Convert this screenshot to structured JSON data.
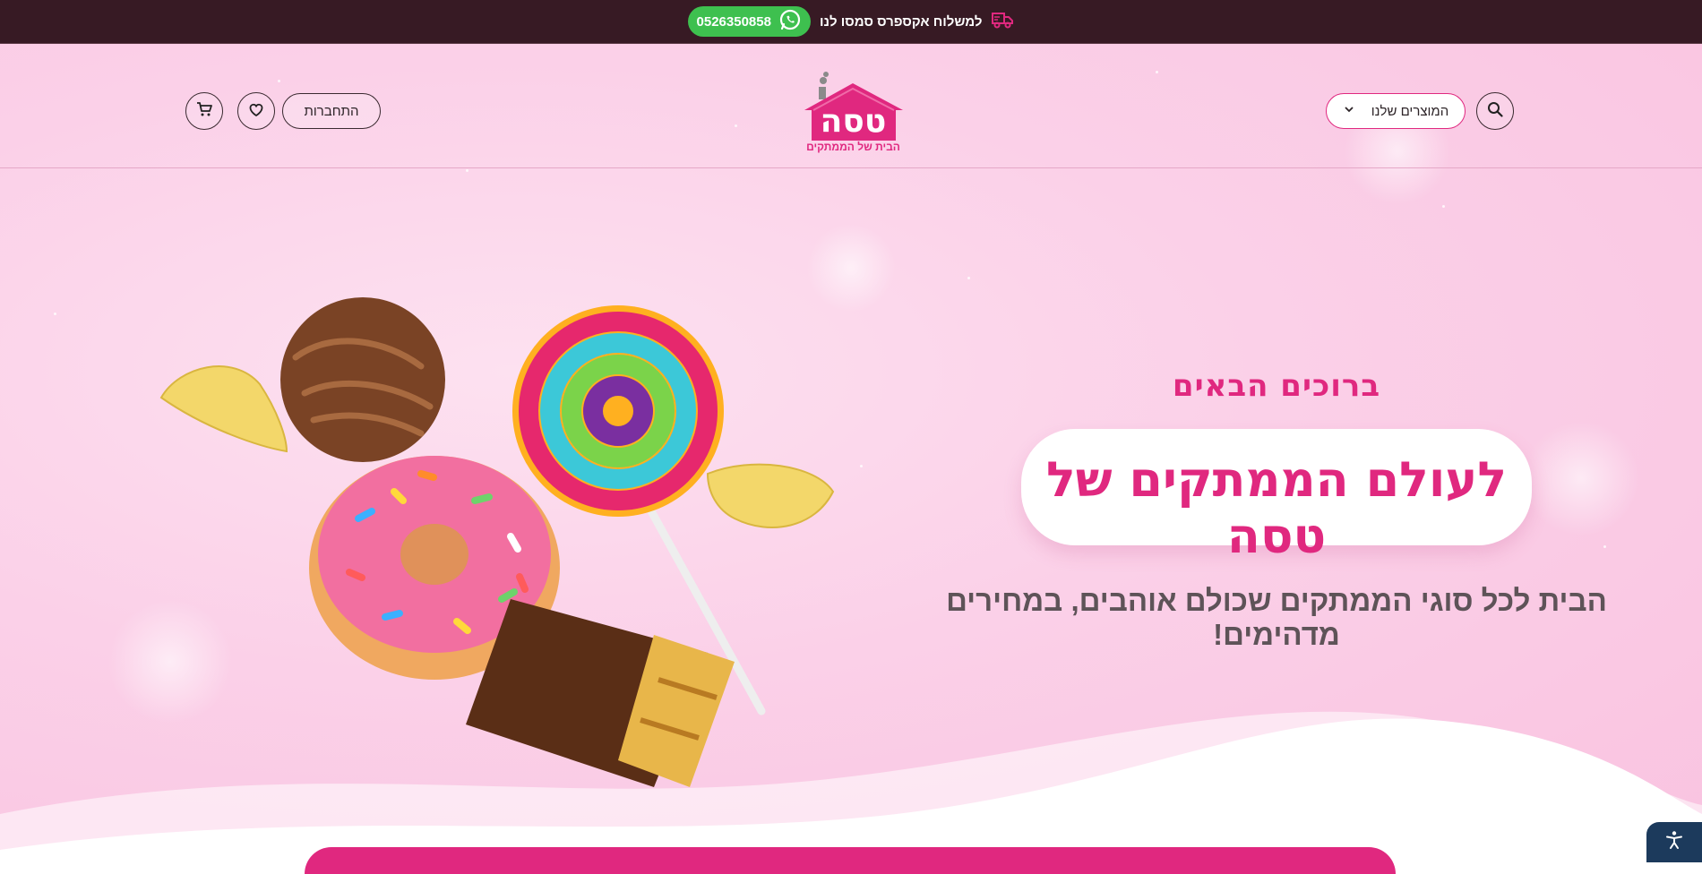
{
  "topbar": {
    "promo_text": "למשלוח אקספרס סמסו לנו",
    "phone": "0526350858",
    "truck_icon": "delivery-truck-icon",
    "whatsapp_icon": "whatsapp-icon"
  },
  "header": {
    "products_label": "המוצרים שלנו",
    "login_label": "התחברות",
    "logo_name": "טסה",
    "logo_tagline": "הבית של הממתקים"
  },
  "hero": {
    "welcome": "ברוכים הבאים",
    "title": "לעולם הממתקים של טסה",
    "subtitle": "הבית לכל סוגי הממתקים שכולם אוהבים, במחירים מדהימים!"
  },
  "colors": {
    "topbar_bg": "#371a24",
    "brand_pink": "#e0287f",
    "whatsapp_green": "#3ec04f",
    "hero_bg": "#fbd0e8",
    "a11y_bg": "#1c3a5c"
  },
  "icons": [
    "search-icon",
    "chevron-down-icon",
    "heart-icon",
    "cart-icon",
    "accessibility-icon"
  ]
}
